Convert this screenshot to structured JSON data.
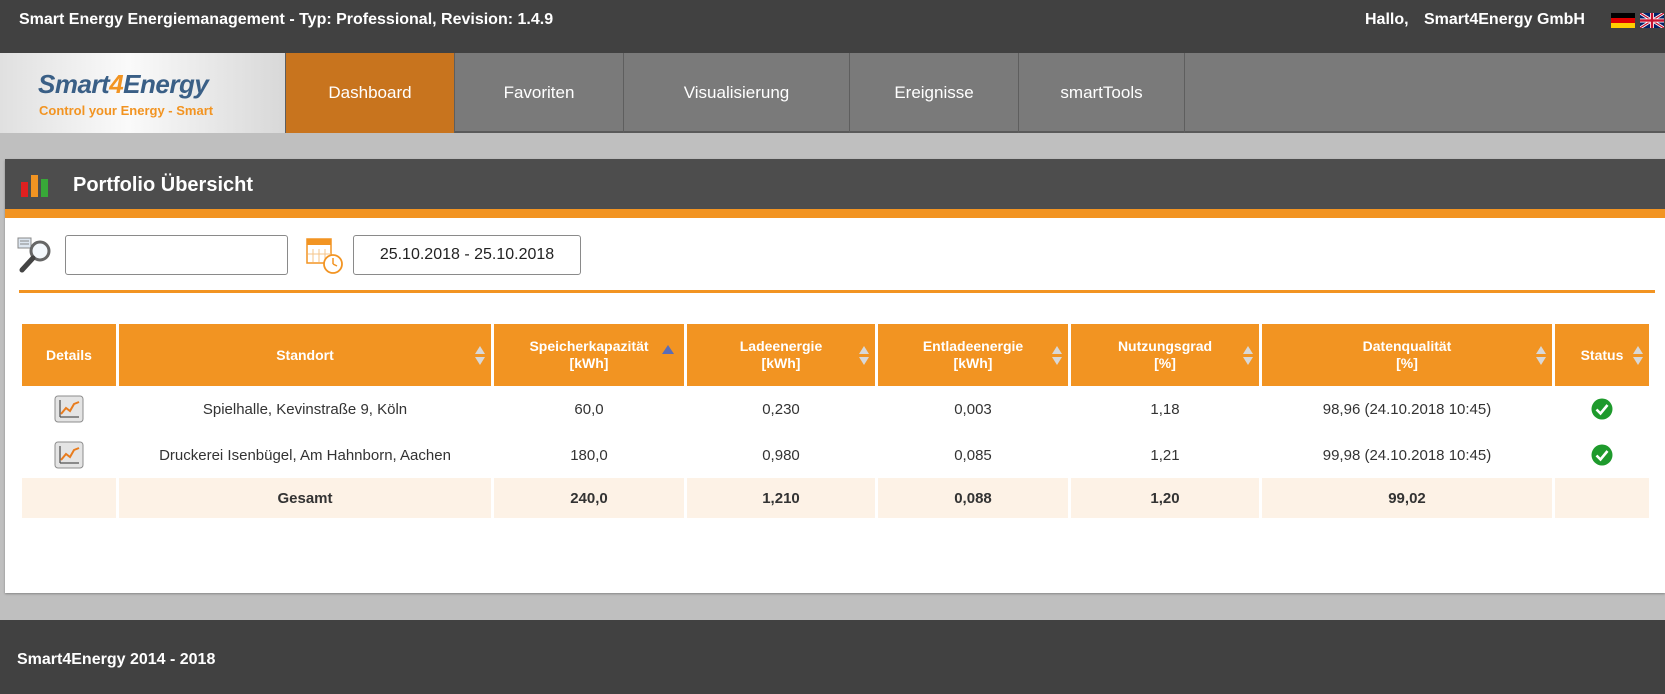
{
  "header": {
    "app_title": "Smart Energy Energiemanagement - Typ: Professional, Revision: 1.4.9",
    "greeting": "Hallo,",
    "user": "Smart4Energy GmbH"
  },
  "logo": {
    "brand_part1": "Smart",
    "brand_four": "4",
    "brand_part2": "Energy",
    "slogan": "Control your Energy - Smart"
  },
  "nav": {
    "tabs": [
      {
        "label": "Dashboard",
        "active": true
      },
      {
        "label": "Favoriten",
        "active": false
      },
      {
        "label": "Visualisierung",
        "active": false
      },
      {
        "label": "Ereignisse",
        "active": false
      },
      {
        "label": "smartTools",
        "active": false
      }
    ]
  },
  "panel": {
    "title": "Portfolio Übersicht"
  },
  "filters": {
    "search_value": "",
    "date_range": "25.10.2018 - 25.10.2018"
  },
  "table": {
    "headers": [
      {
        "line1": "Details",
        "line2": ""
      },
      {
        "line1": "Standort",
        "line2": ""
      },
      {
        "line1": "Speicherkapazität",
        "line2": "[kWh]"
      },
      {
        "line1": "Ladeenergie",
        "line2": "[kWh]"
      },
      {
        "line1": "Entladeenergie",
        "line2": "[kWh]"
      },
      {
        "line1": "Nutzungsgrad",
        "line2": "[%]"
      },
      {
        "line1": "Datenqualität",
        "line2": "[%]"
      },
      {
        "line1": "Status",
        "line2": ""
      }
    ],
    "sorted_column": "Speicherkapazität",
    "rows": [
      {
        "standort": "Spielhalle, Kevinstraße 9, Köln",
        "kapazitaet": "60,0",
        "lade": "0,230",
        "entlade": "0,003",
        "nutzung": "1,18",
        "qualitaet": "98,96 (24.10.2018 10:45)",
        "status": "ok"
      },
      {
        "standort": "Druckerei Isenbügel, Am Hahnborn, Aachen",
        "kapazitaet": "180,0",
        "lade": "0,980",
        "entlade": "0,085",
        "nutzung": "1,21",
        "qualitaet": "99,98 (24.10.2018 10:45)",
        "status": "ok"
      }
    ],
    "total": {
      "label": "Gesamt",
      "kapazitaet": "240,0",
      "lade": "1,210",
      "entlade": "0,088",
      "nutzung": "1,20",
      "qualitaet": "99,02"
    }
  },
  "footer": {
    "text": "Smart4Energy 2014 - 2018"
  },
  "colors": {
    "accent": "#f29422",
    "active_tab": "#c8741e",
    "status_ok": "#1e9a2c"
  }
}
